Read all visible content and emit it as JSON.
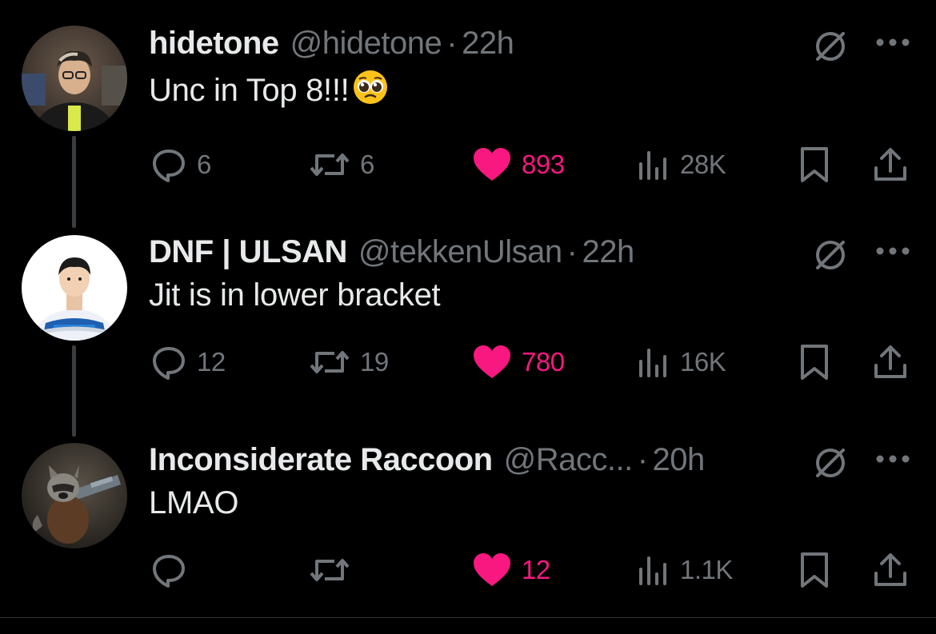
{
  "colors": {
    "background": "#000000",
    "text_primary": "#e7e9ea",
    "text_secondary": "#71767b",
    "like_active": "#f91880",
    "thread_line": "#3a3d40"
  },
  "icons": [
    "reply-icon",
    "retweet-icon",
    "like-icon",
    "views-icon",
    "bookmark-icon",
    "share-icon",
    "grok-icon",
    "more-icon"
  ],
  "tweets": [
    {
      "display_name": "hidetone",
      "handle": "@hidetone",
      "separator": "·",
      "time": "22h",
      "text": "Unc in Top 8!!!",
      "emoji": "pleading-face-emoji",
      "replies": "6",
      "retweets": "6",
      "likes": "893",
      "liked": true,
      "views": "28K"
    },
    {
      "display_name": "DNF | ULSAN",
      "handle": "@tekkenUlsan",
      "separator": "·",
      "time": "22h",
      "text": "Jit is in lower bracket",
      "replies": "12",
      "retweets": "19",
      "likes": "780",
      "liked": true,
      "views": "16K"
    },
    {
      "display_name": "Inconsiderate Raccoon",
      "handle": "@Racc...",
      "separator": "·",
      "time": "20h",
      "text": "LMAO",
      "replies": "",
      "retweets": "",
      "likes": "12",
      "liked": true,
      "views": "1.1K"
    }
  ]
}
